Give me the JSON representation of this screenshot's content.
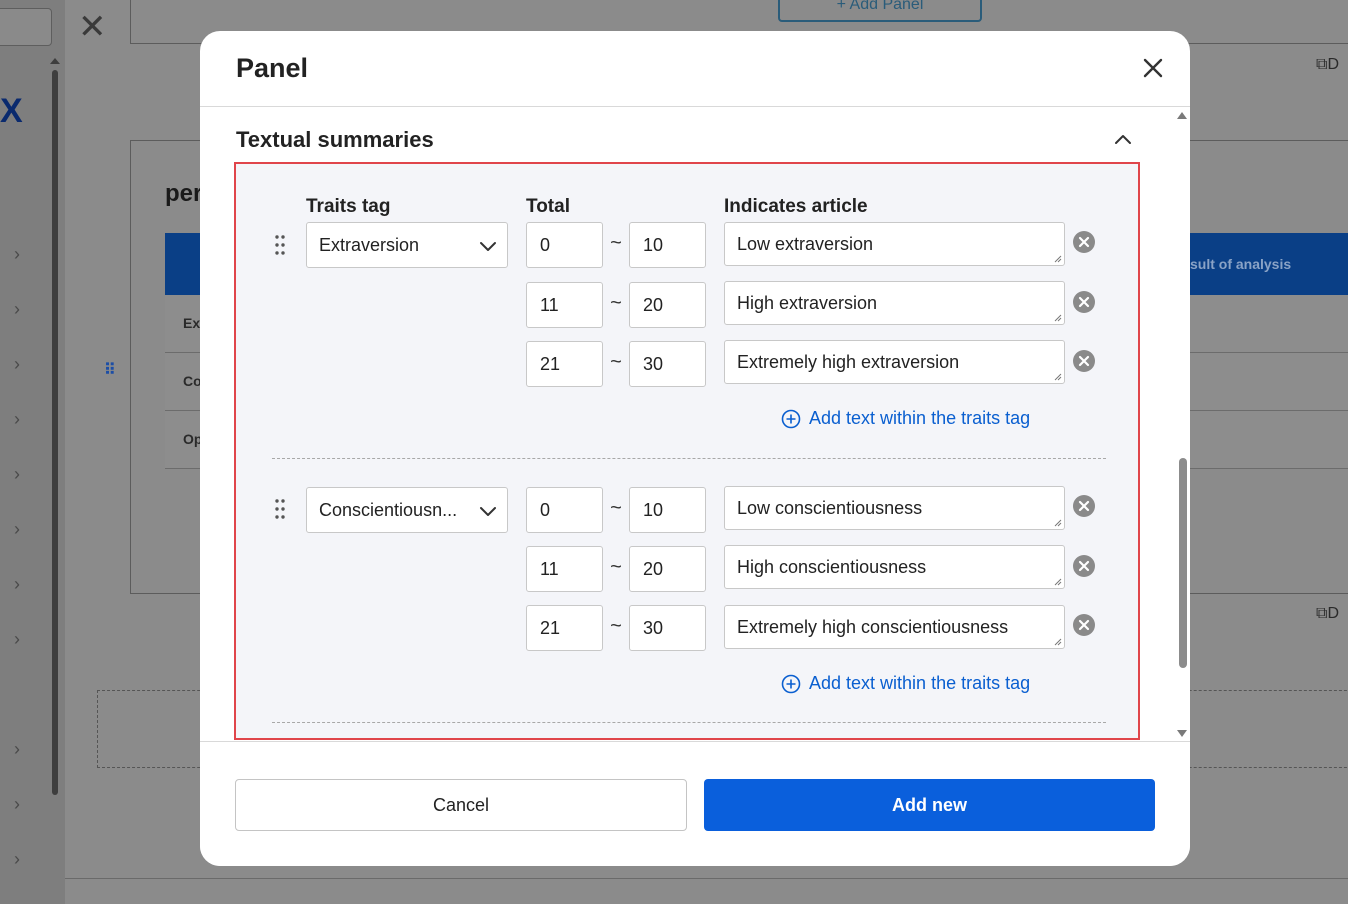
{
  "background": {
    "logo_fragment": "X",
    "add_panel_label": "+ Add Panel",
    "card_title_fragment": "per",
    "table_header_fragment": "sult of analysis",
    "rows": [
      "Ex",
      "Co",
      "Op"
    ],
    "copy_label": "D"
  },
  "modal": {
    "title": "Panel",
    "section_title": "Textual summaries",
    "columns": {
      "traits": "Traits tag",
      "total": "Total",
      "article": "Indicates article"
    },
    "groups": [
      {
        "trait": "Extraversion",
        "rows": [
          {
            "min": "0",
            "max": "10",
            "text": "Low extraversion"
          },
          {
            "min": "11",
            "max": "20",
            "text": "High extraversion"
          },
          {
            "min": "21",
            "max": "30",
            "text": "Extremely high extraversion"
          }
        ],
        "add_label": "Add text within the traits tag"
      },
      {
        "trait": "Conscientiousn...",
        "rows": [
          {
            "min": "0",
            "max": "10",
            "text": "Low conscientiousness"
          },
          {
            "min": "11",
            "max": "20",
            "text": "High conscientiousness"
          },
          {
            "min": "21",
            "max": "30",
            "text": "Extremely high conscientiousness"
          }
        ],
        "add_label": "Add text within the traits tag"
      }
    ],
    "range_separator": "~",
    "cancel_label": "Cancel",
    "submit_label": "Add new"
  },
  "colors": {
    "accent": "#0a5fdc",
    "highlight_border": "#e0454b",
    "link": "#0a5fd0"
  }
}
